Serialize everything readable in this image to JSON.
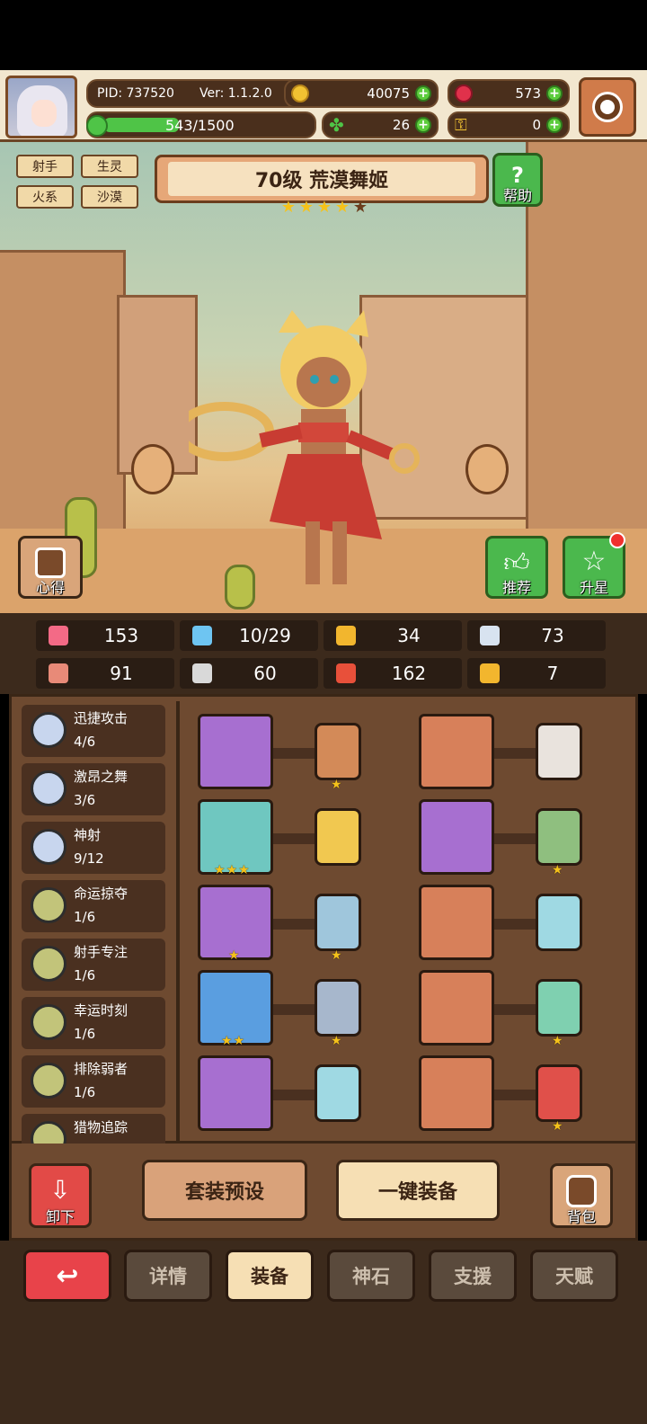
{
  "header": {
    "pid": "PID: 737520",
    "version": "Ver: 1.1.2.0",
    "gold": "40075",
    "gems": "573",
    "energy": "543/1500",
    "energy_fraction": 0.362,
    "clovers": "26",
    "keys": "0"
  },
  "tags": [
    "射手",
    "生灵",
    "火系",
    "沙漠"
  ],
  "hero": {
    "title": "70级  荒漠舞姬",
    "stars_filled": 4,
    "stars_total": 5
  },
  "buttons": {
    "help": "帮助",
    "notes": "心得",
    "recommend": "推荐",
    "star_up": "升星",
    "unequip": "卸下",
    "preset": "套装预设",
    "auto_equip": "一键装备",
    "bag": "背包"
  },
  "stats": [
    {
      "icon": "heart-icon",
      "value": "153"
    },
    {
      "icon": "water-drop-icon",
      "value": "10/29"
    },
    {
      "icon": "shield-icon",
      "value": "34"
    },
    {
      "icon": "wing-icon",
      "value": "73"
    },
    {
      "icon": "fist-icon",
      "value": "91"
    },
    {
      "icon": "book-icon",
      "value": "60"
    },
    {
      "icon": "flag-icon",
      "value": "162"
    },
    {
      "icon": "horseshoe-icon",
      "value": "7"
    }
  ],
  "skills": [
    {
      "name": "迅捷攻击",
      "level": "4/6",
      "color": "#c8d6ee"
    },
    {
      "name": "激昂之舞",
      "level": "3/6",
      "color": "#c8d6ee"
    },
    {
      "name": "神射",
      "level": "9/12",
      "color": "#c8d6ee"
    },
    {
      "name": "命运掠夺",
      "level": "1/6",
      "color": "#c2c47a"
    },
    {
      "name": "射手专注",
      "level": "1/6",
      "color": "#c2c47a"
    },
    {
      "name": "幸运时刻",
      "level": "1/6",
      "color": "#c2c47a"
    },
    {
      "name": "排除弱者",
      "level": "1/6",
      "color": "#c2c47a"
    },
    {
      "name": "猎物追踪",
      "level": "",
      "color": "#c2c47a"
    }
  ],
  "equipment_left": [
    {
      "item": "bow-icon",
      "bg": "#a76fd0",
      "item_stars": 0,
      "card_bg": "#d38a58",
      "card_stars": 1
    },
    {
      "item": "arrow-icon",
      "bg": "#6fc7c0",
      "item_stars": 3,
      "card_bg": "#f1c850",
      "card_stars": 0
    },
    {
      "item": "necklace-icon",
      "bg": "#a76fd0",
      "item_stars": 1,
      "card_bg": "#9fc6dc",
      "card_stars": 1
    },
    {
      "item": "orb-icon",
      "bg": "#5a9ee0",
      "item_stars": 2,
      "card_bg": "#a7b7cc",
      "card_stars": 1
    },
    {
      "item": "ring-icon",
      "bg": "#a76fd0",
      "item_stars": 0,
      "card_bg": "#9fd9e3",
      "card_stars": 0
    }
  ],
  "equipment_right": [
    {
      "item": "armor-icon",
      "bg": "#d7805a",
      "item_stars": 0,
      "card_bg": "#e9e3dd",
      "card_stars": 0
    },
    {
      "item": "shoulder-icon",
      "bg": "#a76fd0",
      "item_stars": 0,
      "card_bg": "#8fbf7f",
      "card_stars": 1
    },
    {
      "item": "bracelet-icon",
      "bg": "#d7805a",
      "item_stars": 0,
      "card_bg": "#9fd9e3",
      "card_stars": 0
    },
    {
      "item": "belt-icon",
      "bg": "#d7805a",
      "item_stars": 0,
      "card_bg": "#7fd0b0",
      "card_stars": 1
    },
    {
      "item": "boots-icon",
      "bg": "#d7805a",
      "item_stars": 0,
      "card_bg": "#e0504a",
      "card_stars": 1
    }
  ],
  "tabs": [
    {
      "label": "详情",
      "active": false
    },
    {
      "label": "装备",
      "active": true
    },
    {
      "label": "神石",
      "active": false
    },
    {
      "label": "支援",
      "active": false
    },
    {
      "label": "天赋",
      "active": false
    }
  ]
}
